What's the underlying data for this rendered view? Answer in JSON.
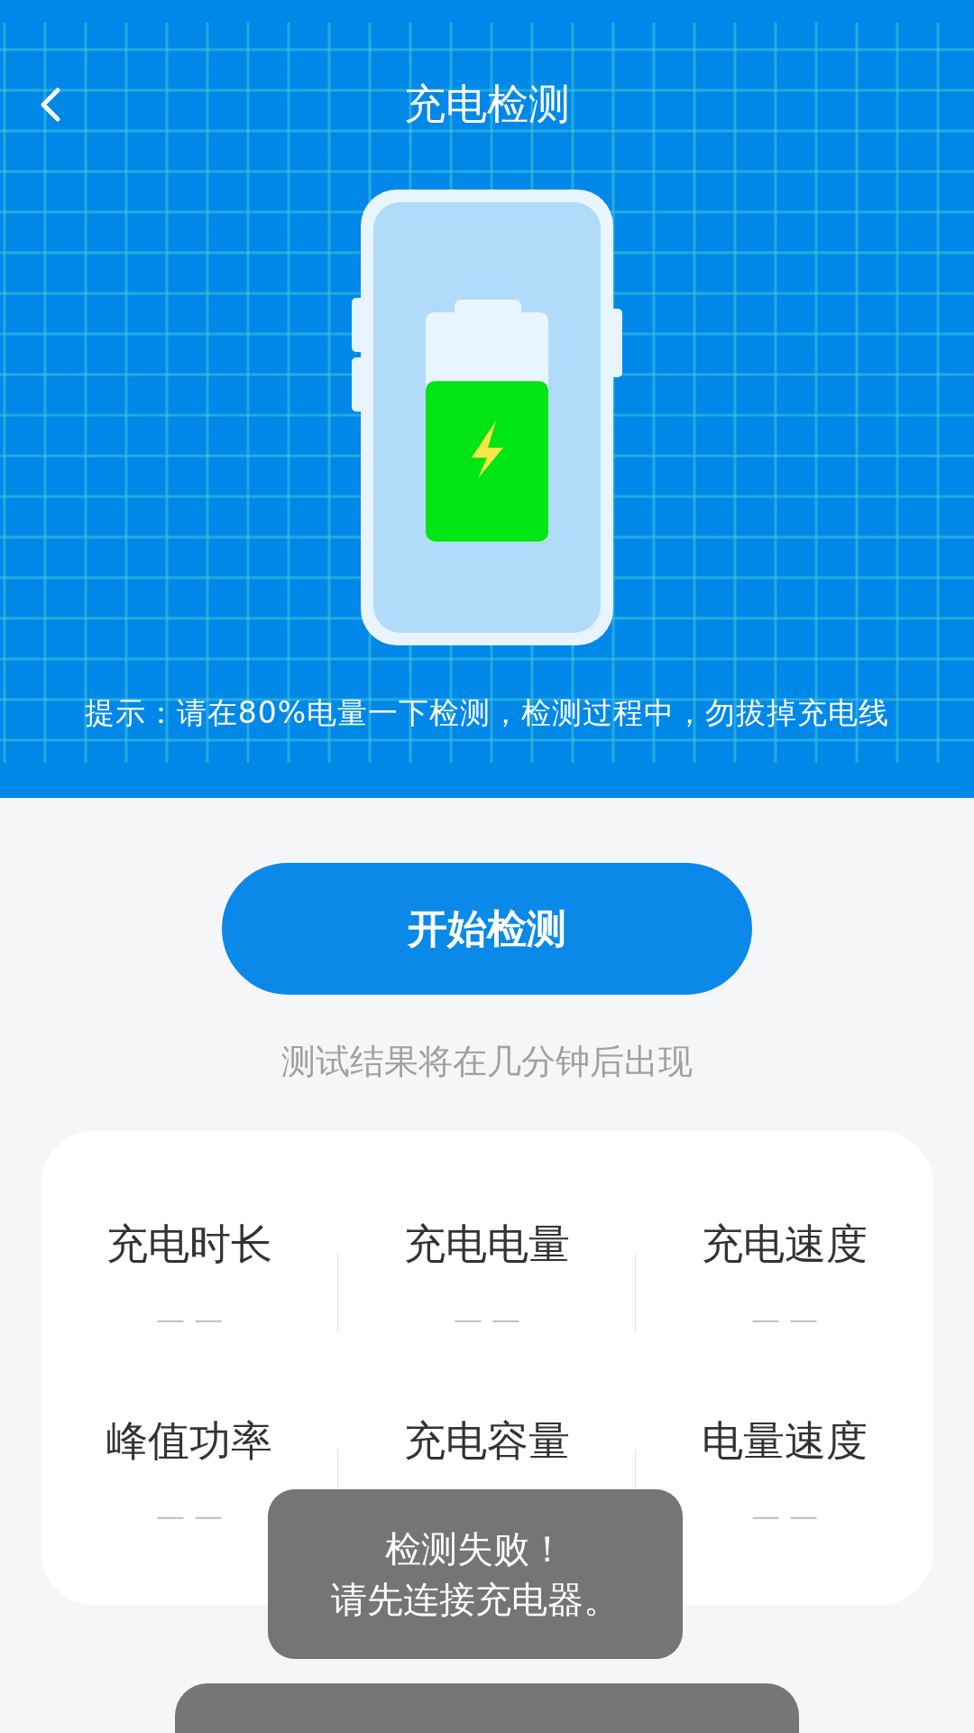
{
  "header": {
    "title": "充电检测",
    "hint": "提示：请在80%电量一下检测，检测过程中，勿拔掉充电线"
  },
  "illustration": {
    "level": 0.7
  },
  "start_button": "开始检测",
  "subtitle": "测试结果将在几分钟后出现",
  "stats": [
    {
      "label": "充电时长",
      "value": "— —"
    },
    {
      "label": "充电电量",
      "value": "— —"
    },
    {
      "label": "充电速度",
      "value": "— —"
    },
    {
      "label": "峰值功率",
      "value": "— —"
    },
    {
      "label": "充电容量"
    },
    {
      "label": "电量速度",
      "value": "— —"
    }
  ],
  "toast": [
    "检测失败！",
    "请先连接充电器。"
  ]
}
